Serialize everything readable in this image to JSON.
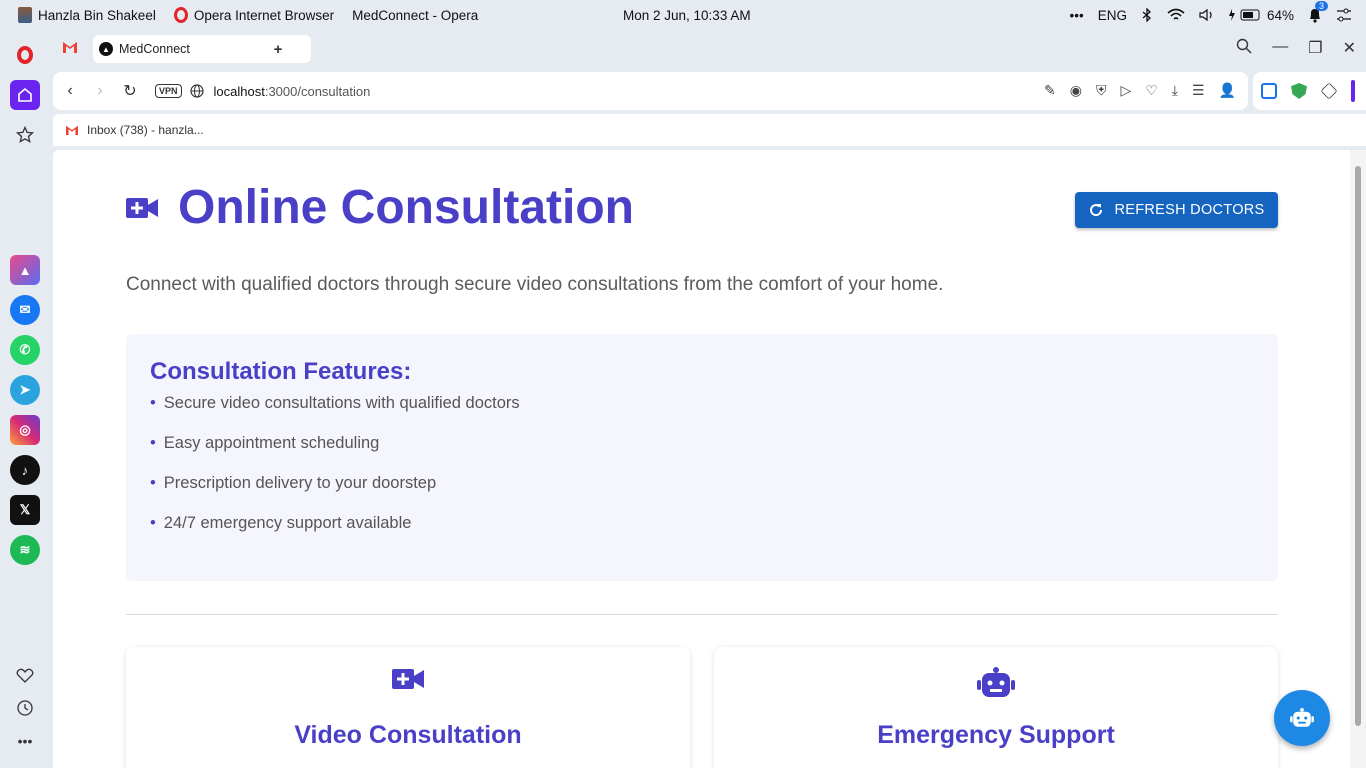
{
  "os": {
    "user": "Hanzla Bin Shakeel",
    "browser_name": "Opera Internet Browser",
    "window_title": "MedConnect - Opera",
    "datetime": "Mon 2 Jun, 10:33 AM",
    "more": "•••",
    "lang": "ENG",
    "battery": "64%",
    "notif_count": "3"
  },
  "tab": {
    "title": "MedConnect"
  },
  "address": {
    "vpn": "VPN",
    "host": "localhost",
    "path": ":3000/consultation"
  },
  "bookmarks": [
    {
      "label": "Inbox (738) - hanzla..."
    }
  ],
  "page": {
    "title": "Online Consultation",
    "refresh_label": "REFRESH DOCTORS",
    "intro": "Connect with qualified doctors through secure video consultations from the comfort of your home.",
    "features_title": "Consultation Features:",
    "features": [
      "Secure video consultations with qualified doctors",
      "Easy appointment scheduling",
      "Prescription delivery to your doorstep",
      "24/7 emergency support available"
    ],
    "cards": [
      {
        "title": "Video Consultation",
        "icon": "video-plus-icon"
      },
      {
        "title": "Emergency Support",
        "icon": "robot-icon"
      }
    ]
  },
  "colors": {
    "accent": "#4a3fc7",
    "button": "#1565c0",
    "opera_purple": "#6a24f0"
  }
}
